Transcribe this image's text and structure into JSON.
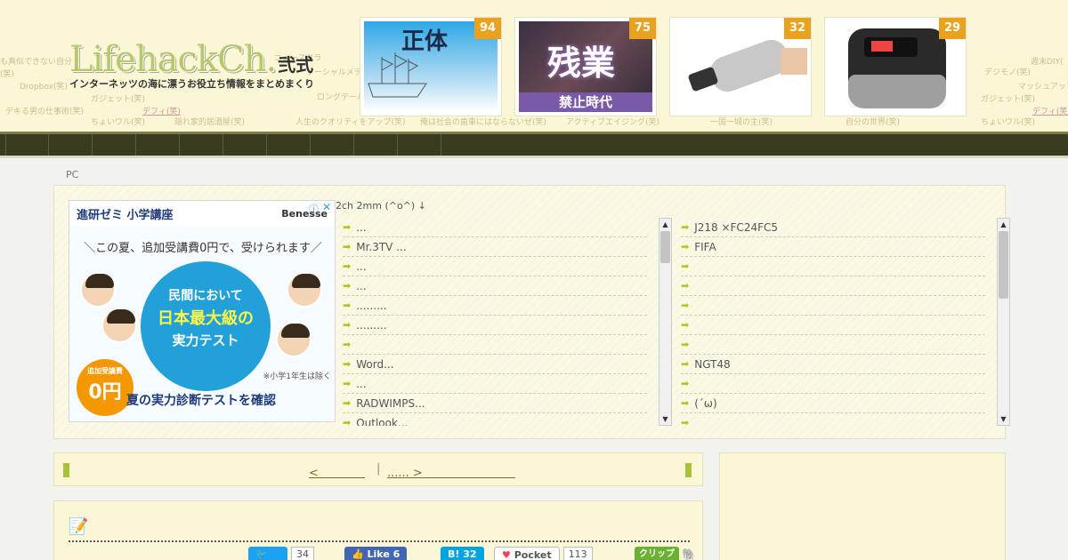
{
  "header": {
    "logo_main": "LifehackCh.",
    "logo_sub": "弐式",
    "tagline": "インターネッツの海に漂うお役立ち情報をまとめまくり",
    "tags": [
      "も真似できない自分",
      "(笑)",
      "ソーシャルメデ",
      "ニュースクラ",
      "Dropbox(笑)",
      "ガジェット(笑)",
      "ロングテール",
      "マッシュアップ(笑)",
      "デキる男の仕事術(笑)",
      "デフィ(笑)",
      "ちょいワル(笑)",
      "隠れ家的居酒屋(笑)",
      "人生のクオリティをアップ(笑)",
      "俺は社会の歯車にはならないぜ(笑)",
      "アクティブエイジング(笑)",
      "一国一城の主(笑)",
      "自分の世界(笑)",
      "デジモノ(笑)",
      "週末DIY(",
      "マッシュアッフ",
      "ガジェット(笑)",
      "デフィ(笑)",
      "ちょいワル(笑)"
    ],
    "thumbs": [
      {
        "count": "94",
        "label": "正体"
      },
      {
        "count": "75",
        "label": "残業",
        "sub": "禁止時代"
      },
      {
        "count": "32"
      },
      {
        "count": "29"
      }
    ]
  },
  "breadcrumb": "PC",
  "ad": {
    "brand": "進研ゼミ 小学講座",
    "benesse": "Benesse",
    "slogan": "＼この夏、追加受講費0円で、受けられます／",
    "circle_l1": "民間において",
    "circle_l2": "日本最大級の",
    "circle_l3": "実力テスト",
    "note": "※小学1年生は除く",
    "badge_top": "追加受講費",
    "badge_price": "0円",
    "cta": "夏の実力診断テストを確認"
  },
  "feed": {
    "title": "2ch  2mm (^o^) ↓",
    "left": [
      "...",
      "Mr.3TV ...",
      "...",
      "...",
      ".........",
      ".........",
      "",
      "Word...",
      " ...",
      "RADWIMPS...",
      "Outlook..."
    ],
    "right": [
      "J218 ×FC24FC5",
      "FIFA",
      "",
      "",
      "",
      "",
      "",
      "NGT48",
      "",
      "(´ω)",
      ""
    ]
  },
  "pager": {
    "prev": "<　　　　",
    "sep": "|",
    "next": "...... >　　　　　　　　"
  },
  "share": {
    "twitter_count": "34",
    "facebook_label": "Like",
    "facebook_count": "6",
    "hatena_label": "B!",
    "hatena_count": "32",
    "pocket_label": "Pocket",
    "pocket_count": "113",
    "clip_label": "クリップ"
  },
  "colors": {
    "header_bg": "#fbf7d6",
    "nav_bg": "#3a3a1e",
    "count_badge": "#e9a21d",
    "accent_green": "#a8c23a"
  }
}
